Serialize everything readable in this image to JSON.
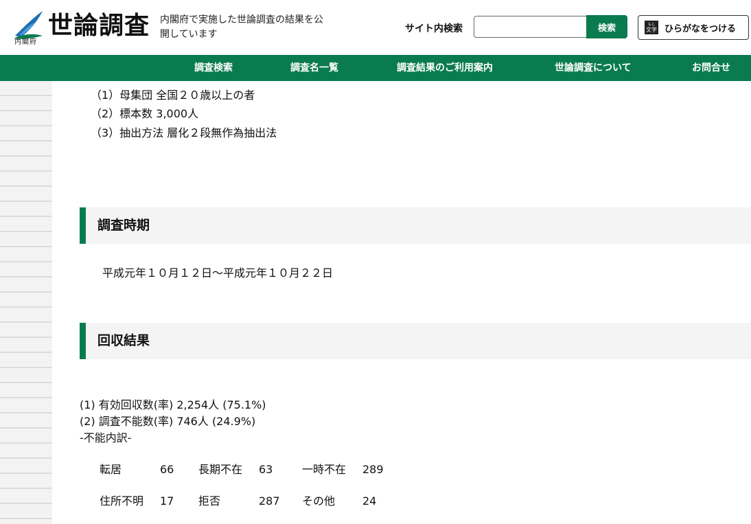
{
  "header": {
    "logo_sub": "内閣府",
    "site_title": "世論調査",
    "tagline": "内閣府で実施した世論調査の結果を公開しています",
    "search_label": "サイト内検索",
    "search_placeholder": "",
    "search_button": "検索",
    "furigana_icon_ruby": "もじ",
    "furigana_icon_text": "文字",
    "furigana_button": "ひらがなをつける"
  },
  "nav": {
    "items": [
      "調査検索",
      "調査名一覧",
      "調査結果のご利用案内",
      "世論調査について",
      "お問合せ"
    ]
  },
  "sampling": {
    "lines": [
      "（1）母集団 全国２０歳以上の者",
      "（2）標本数 3,000人",
      "（3）抽出方法 層化２段無作為抽出法"
    ]
  },
  "period": {
    "heading": "調査時期",
    "text": "平成元年１０月１２日～平成元年１０月２２日"
  },
  "collection": {
    "heading": "回収結果",
    "lines": [
      "(1) 有効回収数(率) 2,254人 (75.1%)",
      "(2) 調査不能数(率) 746人 (24.9%)",
      "-不能内訳-"
    ],
    "breakdown": [
      [
        {
          "label": "転居",
          "value": "66"
        },
        {
          "label": "長期不在",
          "value": "63"
        },
        {
          "label": "一時不在",
          "value": "289"
        }
      ],
      [
        {
          "label": "住所不明",
          "value": "17"
        },
        {
          "label": "拒否",
          "value": "287"
        },
        {
          "label": "その他",
          "value": "24"
        }
      ]
    ]
  },
  "colors": {
    "brand_green": "#0a7b4f",
    "section_bg": "#f4f4f4"
  }
}
